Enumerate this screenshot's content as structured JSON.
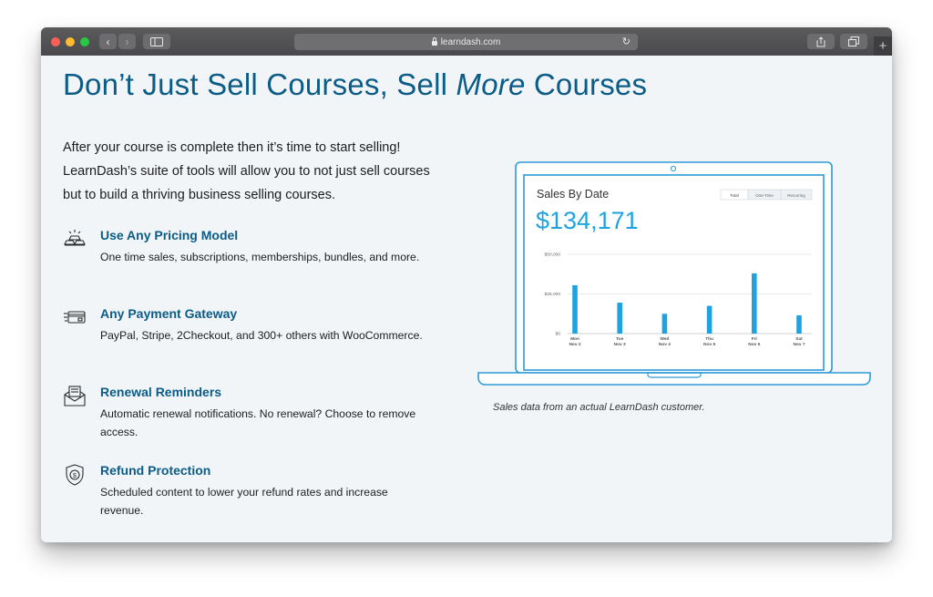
{
  "browser": {
    "url": "learndash.com",
    "traffic_lights": [
      "#ff5f57",
      "#febc2e",
      "#28c840"
    ],
    "back_glyph": "‹",
    "forward_glyph": "›",
    "plus_glyph": "+"
  },
  "page": {
    "heading_pre": "Don’t Just Sell Courses, Sell ",
    "heading_em": "More",
    "heading_post": " Courses",
    "intro": "After your course is complete then it’s time to start selling! LearnDash’s suite of tools will allow you to not just sell courses but to build a thriving business selling courses.",
    "features": [
      {
        "title": "Use Any Pricing Model",
        "desc": "One time sales, subscriptions, memberships, bundles, and more.",
        "icon": "gold-bars-icon"
      },
      {
        "title": "Any Payment Gateway",
        "desc": "PayPal, Stripe, 2Checkout, and 300+ others with WooCommerce.",
        "icon": "credit-card-icon"
      },
      {
        "title": "Renewal Reminders",
        "desc": "Automatic renewal notifications. No renewal? Choose to remove access.",
        "icon": "envelope-icon"
      },
      {
        "title": "Refund Protection",
        "desc": "Scheduled content to lower your refund rates and increase revenue.",
        "icon": "shield-dollar-icon"
      }
    ],
    "caption": "Sales data from an actual LearnDash customer."
  },
  "sales_widget": {
    "title": "Sales By Date",
    "total": "$134,171",
    "toggles": [
      "Total",
      "One-Time",
      "Recurring"
    ],
    "selected_toggle": "Total"
  },
  "colors": {
    "heading": "#0b5c86",
    "accent": "#1fa3e0",
    "laptop_outline": "#2d9ad6"
  },
  "chart_data": {
    "type": "bar",
    "title": "Sales By Date",
    "categories": [
      "Mon Nov 2",
      "Tue Nov 3",
      "Wed Nov 4",
      "Thu Nov 5",
      "Fri Nov 6",
      "Sat Nov 7"
    ],
    "category_lines": [
      [
        "Mon",
        "Nov 2"
      ],
      [
        "Tue",
        "Nov 3"
      ],
      [
        "Wed",
        "Nov 4"
      ],
      [
        "Thu",
        "Nov 5"
      ],
      [
        "Fri",
        "Nov 6"
      ],
      [
        "Sat",
        "Nov 7"
      ]
    ],
    "values": [
      30500,
      19500,
      12500,
      17500,
      38000,
      11500
    ],
    "ylim": [
      0,
      50000
    ],
    "yticks": [
      0,
      25000,
      50000
    ],
    "ytick_labels": [
      "$0",
      "$25,000",
      "$50,000"
    ],
    "grid": true
  }
}
